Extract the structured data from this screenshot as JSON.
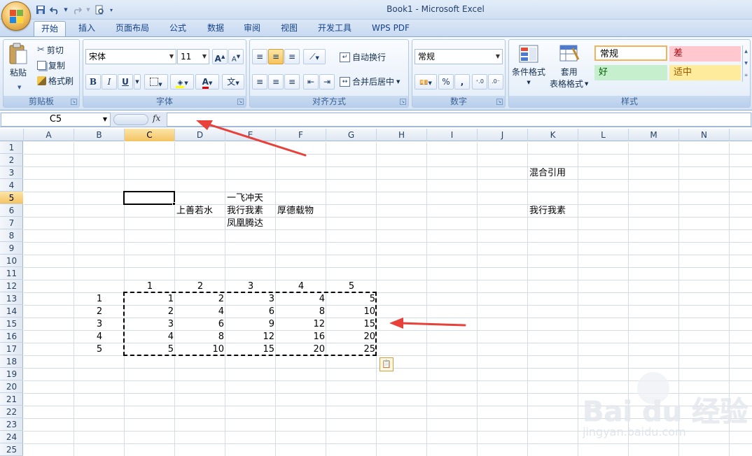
{
  "window": {
    "title": "Book1 - Microsoft Excel"
  },
  "qat": {
    "icons": [
      "save-icon",
      "undo-icon",
      "redo-icon",
      "print-preview-icon",
      "customize-icon"
    ]
  },
  "tabs": [
    {
      "label": "开始",
      "active": true
    },
    {
      "label": "插入"
    },
    {
      "label": "页面布局"
    },
    {
      "label": "公式"
    },
    {
      "label": "数据"
    },
    {
      "label": "审阅"
    },
    {
      "label": "视图"
    },
    {
      "label": "开发工具"
    },
    {
      "label": "WPS PDF"
    }
  ],
  "ribbon": {
    "clipboard": {
      "label": "剪贴板",
      "paste": "粘贴",
      "cut": "剪切",
      "copy": "复制",
      "format_painter": "格式刷"
    },
    "font": {
      "label": "字体",
      "name": "宋体",
      "size": "11",
      "bold": "B",
      "italic": "I",
      "underline": "U",
      "font_color_glyph": "A",
      "phonetic_glyph": "文"
    },
    "alignment": {
      "label": "对齐方式",
      "wrap": "自动换行",
      "merge": "合并后居中"
    },
    "number": {
      "label": "数字",
      "format": "常规",
      "percent": "%",
      "comma": ","
    },
    "styles": {
      "label": "样式",
      "conditional": "条件格式",
      "table_format_1": "套用",
      "table_format_2": "表格格式",
      "normal": "常规",
      "bad": "差",
      "good": "好",
      "neutral": "适中",
      "colors": {
        "bad_bg": "#ffc7ce",
        "bad_fg": "#9c0006",
        "good_bg": "#c6efce",
        "good_fg": "#006100",
        "neutral_bg": "#ffeb9c",
        "neutral_fg": "#9c5700"
      }
    }
  },
  "formula_bar": {
    "name_box": "C5",
    "fx": "fx",
    "content": ""
  },
  "sheet": {
    "columns": [
      "A",
      "B",
      "C",
      "D",
      "E",
      "F",
      "G",
      "H",
      "I",
      "J",
      "K",
      "L",
      "M",
      "N"
    ],
    "rows": [
      "1",
      "2",
      "3",
      "4",
      "5",
      "6",
      "7",
      "8",
      "9",
      "10",
      "11",
      "12",
      "13",
      "14",
      "15",
      "16",
      "17",
      "18",
      "19",
      "20",
      "21",
      "22",
      "23",
      "24",
      "25"
    ],
    "selected_column": "C",
    "selected_row": "5",
    "texts": {
      "K3": "混合引用",
      "E5": "一飞冲天",
      "D6": "上善若水",
      "E6": "我行我素",
      "F6": "厚德载物",
      "E7": "凤凰腾达",
      "K6": "我行我素"
    },
    "header_row_12": [
      "1",
      "2",
      "3",
      "4",
      "5"
    ],
    "header_col_b": [
      "1",
      "2",
      "3",
      "4",
      "5"
    ],
    "table": [
      [
        "1",
        "2",
        "3",
        "4",
        "5"
      ],
      [
        "2",
        "4",
        "6",
        "8",
        "10"
      ],
      [
        "3",
        "6",
        "9",
        "12",
        "15"
      ],
      [
        "4",
        "8",
        "12",
        "16",
        "20"
      ],
      [
        "5",
        "10",
        "15",
        "20",
        "25"
      ]
    ]
  },
  "accent": {
    "arrow": "#e8413a",
    "selection": "#f4c362"
  },
  "watermark": {
    "main": "Bai du 经验",
    "sub": "jingyan.baidu.com"
  }
}
